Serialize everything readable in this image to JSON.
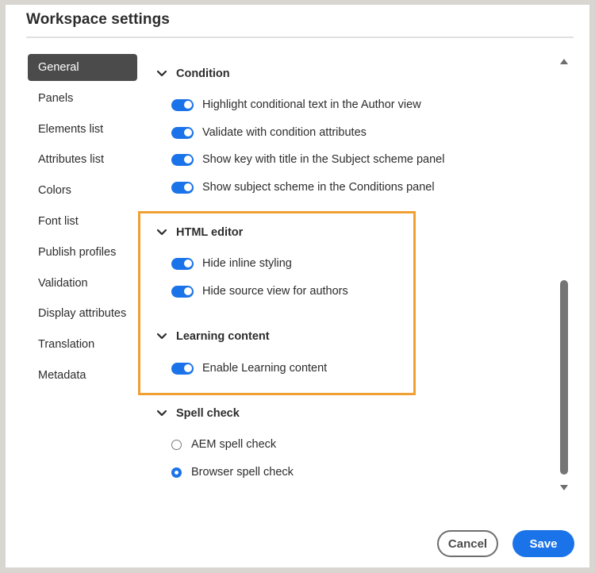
{
  "dialog": {
    "title": "Workspace settings"
  },
  "sidebar": {
    "items": [
      {
        "label": "General",
        "active": true
      },
      {
        "label": "Panels"
      },
      {
        "label": "Elements list"
      },
      {
        "label": "Attributes list"
      },
      {
        "label": "Colors"
      },
      {
        "label": "Font list"
      },
      {
        "label": "Publish profiles"
      },
      {
        "label": "Validation"
      },
      {
        "label": "Display attributes"
      },
      {
        "label": "Translation"
      },
      {
        "label": "Metadata"
      }
    ]
  },
  "sections": {
    "condition": {
      "title": "Condition",
      "options": [
        {
          "label": "Highlight conditional text in the Author view",
          "enabled": true
        },
        {
          "label": "Validate with condition attributes",
          "enabled": true
        },
        {
          "label": "Show key with title in the Subject scheme panel",
          "enabled": true
        },
        {
          "label": "Show subject scheme in the Conditions panel",
          "enabled": true
        }
      ]
    },
    "html_editor": {
      "title": "HTML editor",
      "options": [
        {
          "label": "Hide inline styling",
          "enabled": true
        },
        {
          "label": "Hide source view for authors",
          "enabled": true
        }
      ]
    },
    "learning_content": {
      "title": "Learning content",
      "options": [
        {
          "label": "Enable Learning content",
          "enabled": true
        }
      ]
    },
    "spell_check": {
      "title": "Spell check",
      "options": [
        {
          "label": "AEM spell check",
          "selected": false
        },
        {
          "label": "Browser spell check",
          "selected": true
        }
      ]
    }
  },
  "footer": {
    "cancel_label": "Cancel",
    "save_label": "Save"
  },
  "colors": {
    "accent": "#1a73e8",
    "highlight": "#f0a033",
    "nav_active": "#4b4b4b"
  },
  "icons": {
    "section_toggle": "chevron-down-icon",
    "scroll_up": "scroll-up-arrow-icon",
    "scroll_down": "scroll-down-arrow-icon"
  }
}
